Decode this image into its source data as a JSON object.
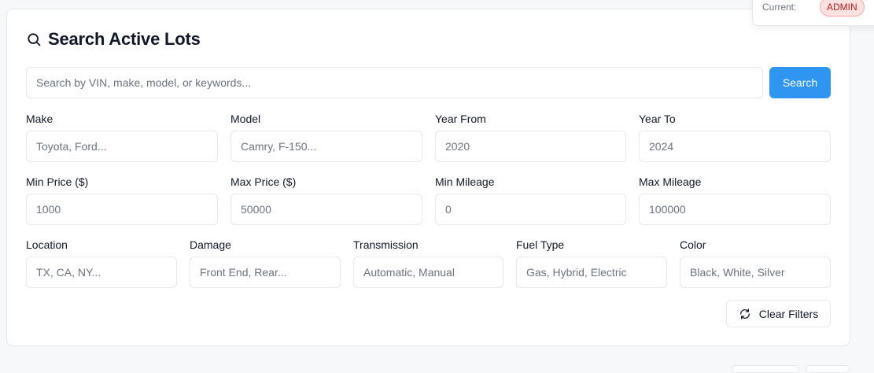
{
  "role": {
    "current_label": "Current:",
    "badge": "ADMIN"
  },
  "search": {
    "title": "Search Active Lots",
    "placeholder": "Search by VIN, make, model, or keywords...",
    "button": "Search"
  },
  "filters": {
    "make": {
      "label": "Make",
      "placeholder": "Toyota, Ford..."
    },
    "model": {
      "label": "Model",
      "placeholder": "Camry, F-150..."
    },
    "year_from": {
      "label": "Year From",
      "placeholder": "2020"
    },
    "year_to": {
      "label": "Year To",
      "placeholder": "2024"
    },
    "min_price": {
      "label": "Min Price ($)",
      "placeholder": "1000"
    },
    "max_price": {
      "label": "Max Price ($)",
      "placeholder": "50000"
    },
    "min_mileage": {
      "label": "Min Mileage",
      "placeholder": "0"
    },
    "max_mileage": {
      "label": "Max Mileage",
      "placeholder": "100000"
    },
    "location": {
      "label": "Location",
      "placeholder": "TX, CA, NY..."
    },
    "damage": {
      "label": "Damage",
      "placeholder": "Front End, Rear..."
    },
    "transmission": {
      "label": "Transmission",
      "placeholder": "Automatic, Manual"
    },
    "fuel_type": {
      "label": "Fuel Type",
      "placeholder": "Gas, Hybrid, Electric"
    },
    "color": {
      "label": "Color",
      "placeholder": "Black, White, Silver"
    }
  },
  "actions": {
    "clear_filters": "Clear Filters"
  },
  "colors": {
    "primary": "#2e96f0",
    "admin_badge_bg": "#fee2e2",
    "admin_badge_text": "#b91c1c"
  }
}
